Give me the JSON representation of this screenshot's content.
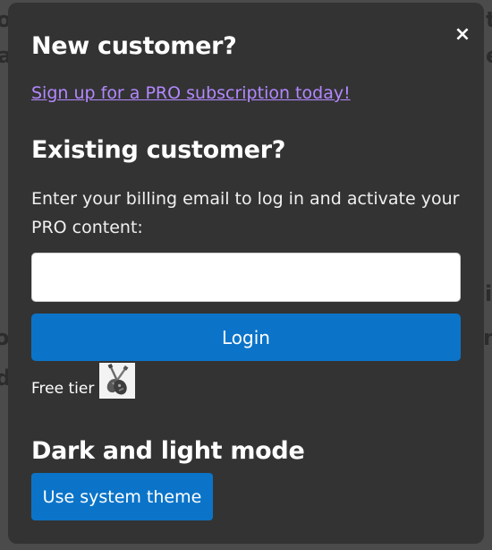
{
  "modal": {
    "close_symbol": "×",
    "new_customer": {
      "heading": "New customer?",
      "signup_link": "Sign up for a PRO subscription today!"
    },
    "existing_customer": {
      "heading": "Existing customer?",
      "instructions": "Enter your billing email to log in and activate your PRO content:",
      "email_value": "",
      "email_placeholder": "",
      "login_label": "Login"
    },
    "free_tier": {
      "label": "Free tier",
      "image_icon": "guitar-icon"
    },
    "theme": {
      "heading": "Dark and light mode",
      "button_label": "Use system theme"
    }
  },
  "colors": {
    "backdrop": "#4b4b4b",
    "modal_bg": "#333333",
    "link": "#b388ff",
    "primary_button": "#0b74c9",
    "text": "#ffffff"
  }
}
